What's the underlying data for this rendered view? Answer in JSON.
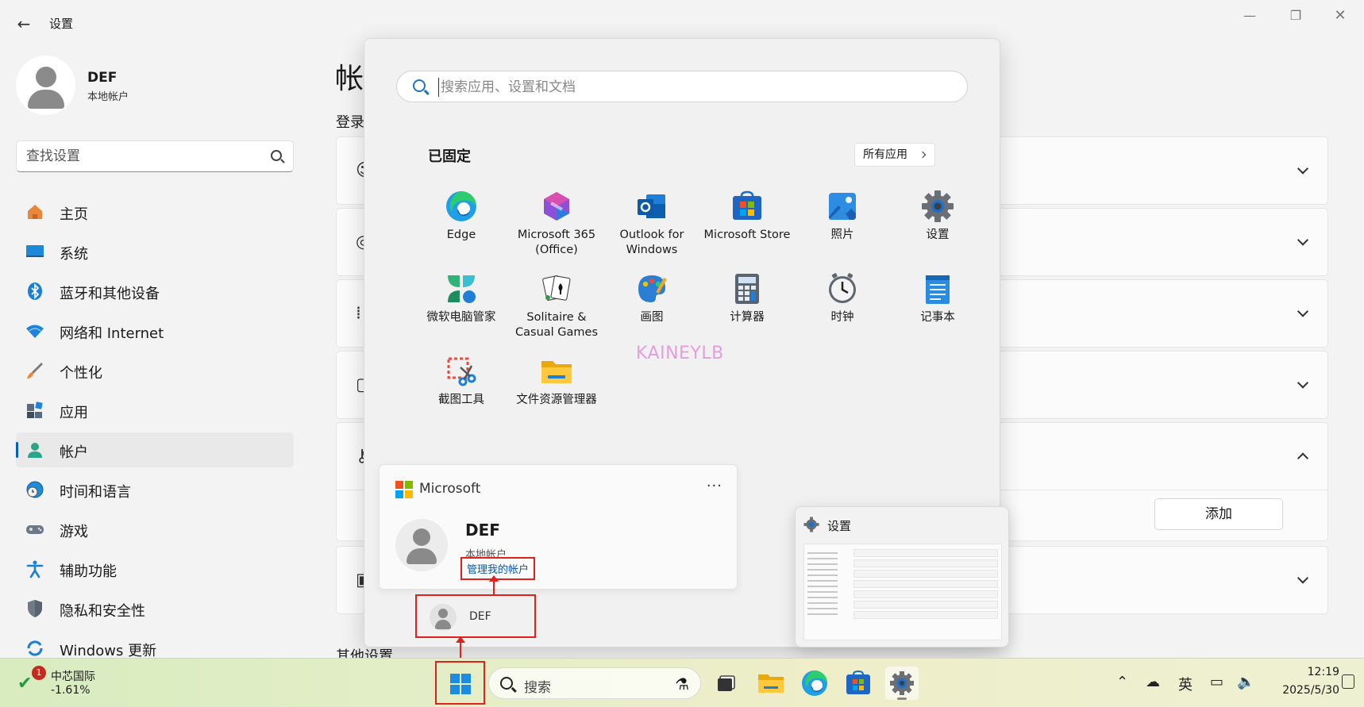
{
  "settings": {
    "title": "设置",
    "profile": {
      "name": "DEF",
      "type": "本地帐户"
    },
    "search_placeholder": "查找设置",
    "nav": [
      {
        "label": "主页",
        "icon": "home-icon"
      },
      {
        "label": "系统",
        "icon": "system-icon"
      },
      {
        "label": "蓝牙和其他设备",
        "icon": "bluetooth-icon"
      },
      {
        "label": "网络和 Internet",
        "icon": "wifi-icon"
      },
      {
        "label": "个性化",
        "icon": "brush-icon"
      },
      {
        "label": "应用",
        "icon": "apps-icon"
      },
      {
        "label": "帐户",
        "icon": "account-icon",
        "active": true
      },
      {
        "label": "时间和语言",
        "icon": "globe-icon"
      },
      {
        "label": "游戏",
        "icon": "gamepad-icon"
      },
      {
        "label": "辅助功能",
        "icon": "accessibility-icon"
      },
      {
        "label": "隐私和安全性",
        "icon": "shield-icon"
      },
      {
        "label": "Windows 更新",
        "icon": "update-icon"
      }
    ],
    "page_title": "帐",
    "section_label": "登录",
    "section_label_2": "其他设置",
    "add_button": "添加"
  },
  "start_menu": {
    "search_placeholder": "搜索应用、设置和文档",
    "pinned_title": "已固定",
    "all_apps": "所有应用",
    "apps": [
      {
        "label": "Edge",
        "icon": "edge-icon"
      },
      {
        "label": "Microsoft 365\n(Office)",
        "icon": "m365-icon"
      },
      {
        "label": "Outlook for\nWindows",
        "icon": "outlook-icon"
      },
      {
        "label": "Microsoft Store",
        "icon": "store-icon"
      },
      {
        "label": "照片",
        "icon": "photos-icon"
      },
      {
        "label": "设置",
        "icon": "settings-gear-icon"
      },
      {
        "label": "微软电脑管家",
        "icon": "pc-manager-icon"
      },
      {
        "label": "Solitaire &\nCasual Games",
        "icon": "solitaire-icon"
      },
      {
        "label": "画图",
        "icon": "paint-icon"
      },
      {
        "label": "计算器",
        "icon": "calculator-icon"
      },
      {
        "label": "时钟",
        "icon": "clock-icon"
      },
      {
        "label": "记事本",
        "icon": "notepad-icon"
      },
      {
        "label": "截图工具",
        "icon": "snipping-tool-icon"
      },
      {
        "label": "文件资源管理器",
        "icon": "file-explorer-icon"
      }
    ],
    "watermark": "KAINEYLB",
    "account_card": {
      "brand": "Microsoft",
      "more": "···",
      "name": "DEF",
      "type": "本地帐户",
      "manage_link": "管理我的帐户"
    },
    "user_button": "DEF"
  },
  "preview": {
    "title": "设置"
  },
  "taskbar": {
    "stock_badge": "1",
    "stock_name": "中芯国际",
    "stock_change": "-1.61%",
    "search_label": "搜索",
    "ime": "英",
    "time": "12:19",
    "date": "2025/5/30"
  },
  "colors": {
    "accent": "#005fb8",
    "highlight_box": "#e0221b",
    "watermark": "#e08bd8"
  }
}
